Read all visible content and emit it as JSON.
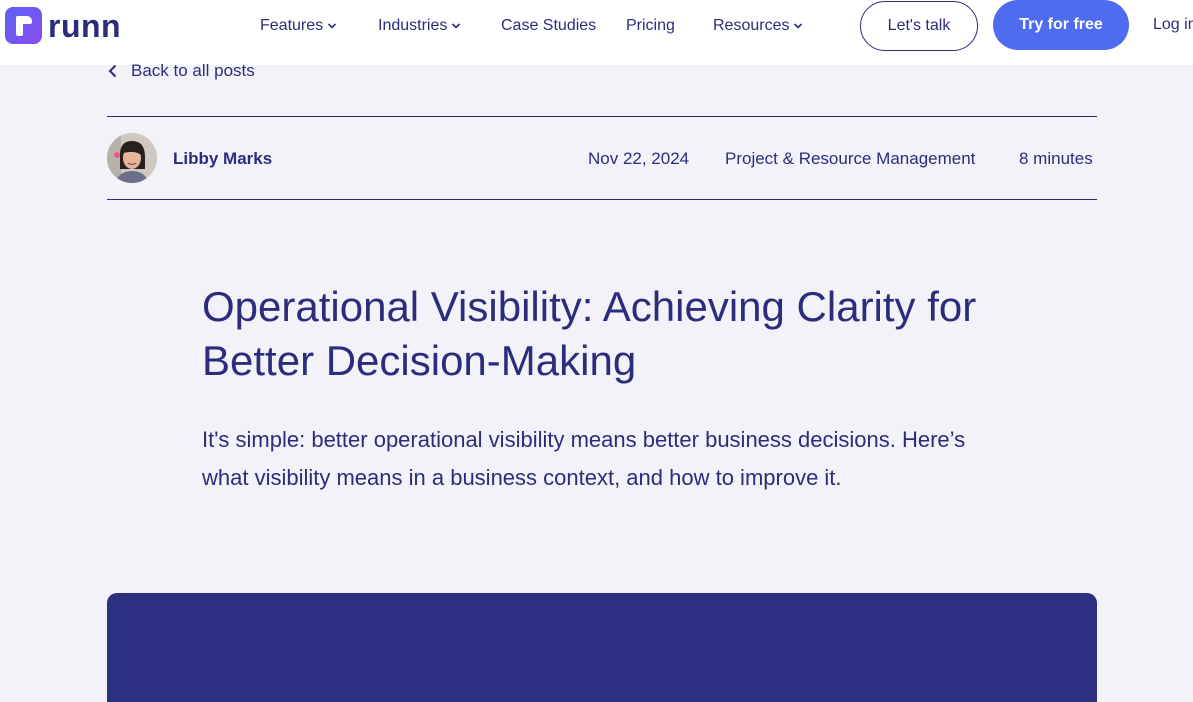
{
  "brand": {
    "name": "runn"
  },
  "nav": {
    "items": [
      {
        "label": "Features",
        "has_dropdown": true
      },
      {
        "label": "Industries",
        "has_dropdown": true
      },
      {
        "label": "Case Studies",
        "has_dropdown": false
      },
      {
        "label": "Pricing",
        "has_dropdown": false
      },
      {
        "label": "Resources",
        "has_dropdown": true
      }
    ],
    "talk_label": "Let's talk",
    "try_label": "Try for free",
    "login_label": "Log in"
  },
  "post": {
    "back_label": "Back to all posts",
    "author": "Libby Marks",
    "date": "Nov 22, 2024",
    "category": "Project & Resource Management",
    "read_time": "8 minutes",
    "title": "Operational Visibility: Achieving Clarity for Better Decision-Making",
    "subtitle": "It's simple: better operational visibility means better business decisions. Here’s what visibility means in a business context, and how to improve it."
  },
  "colors": {
    "brand_navy": "#2b2d7c",
    "accent_blue": "#4f6bf0",
    "page_bg": "#f3f2f8",
    "hero_bg": "#2b3080"
  }
}
